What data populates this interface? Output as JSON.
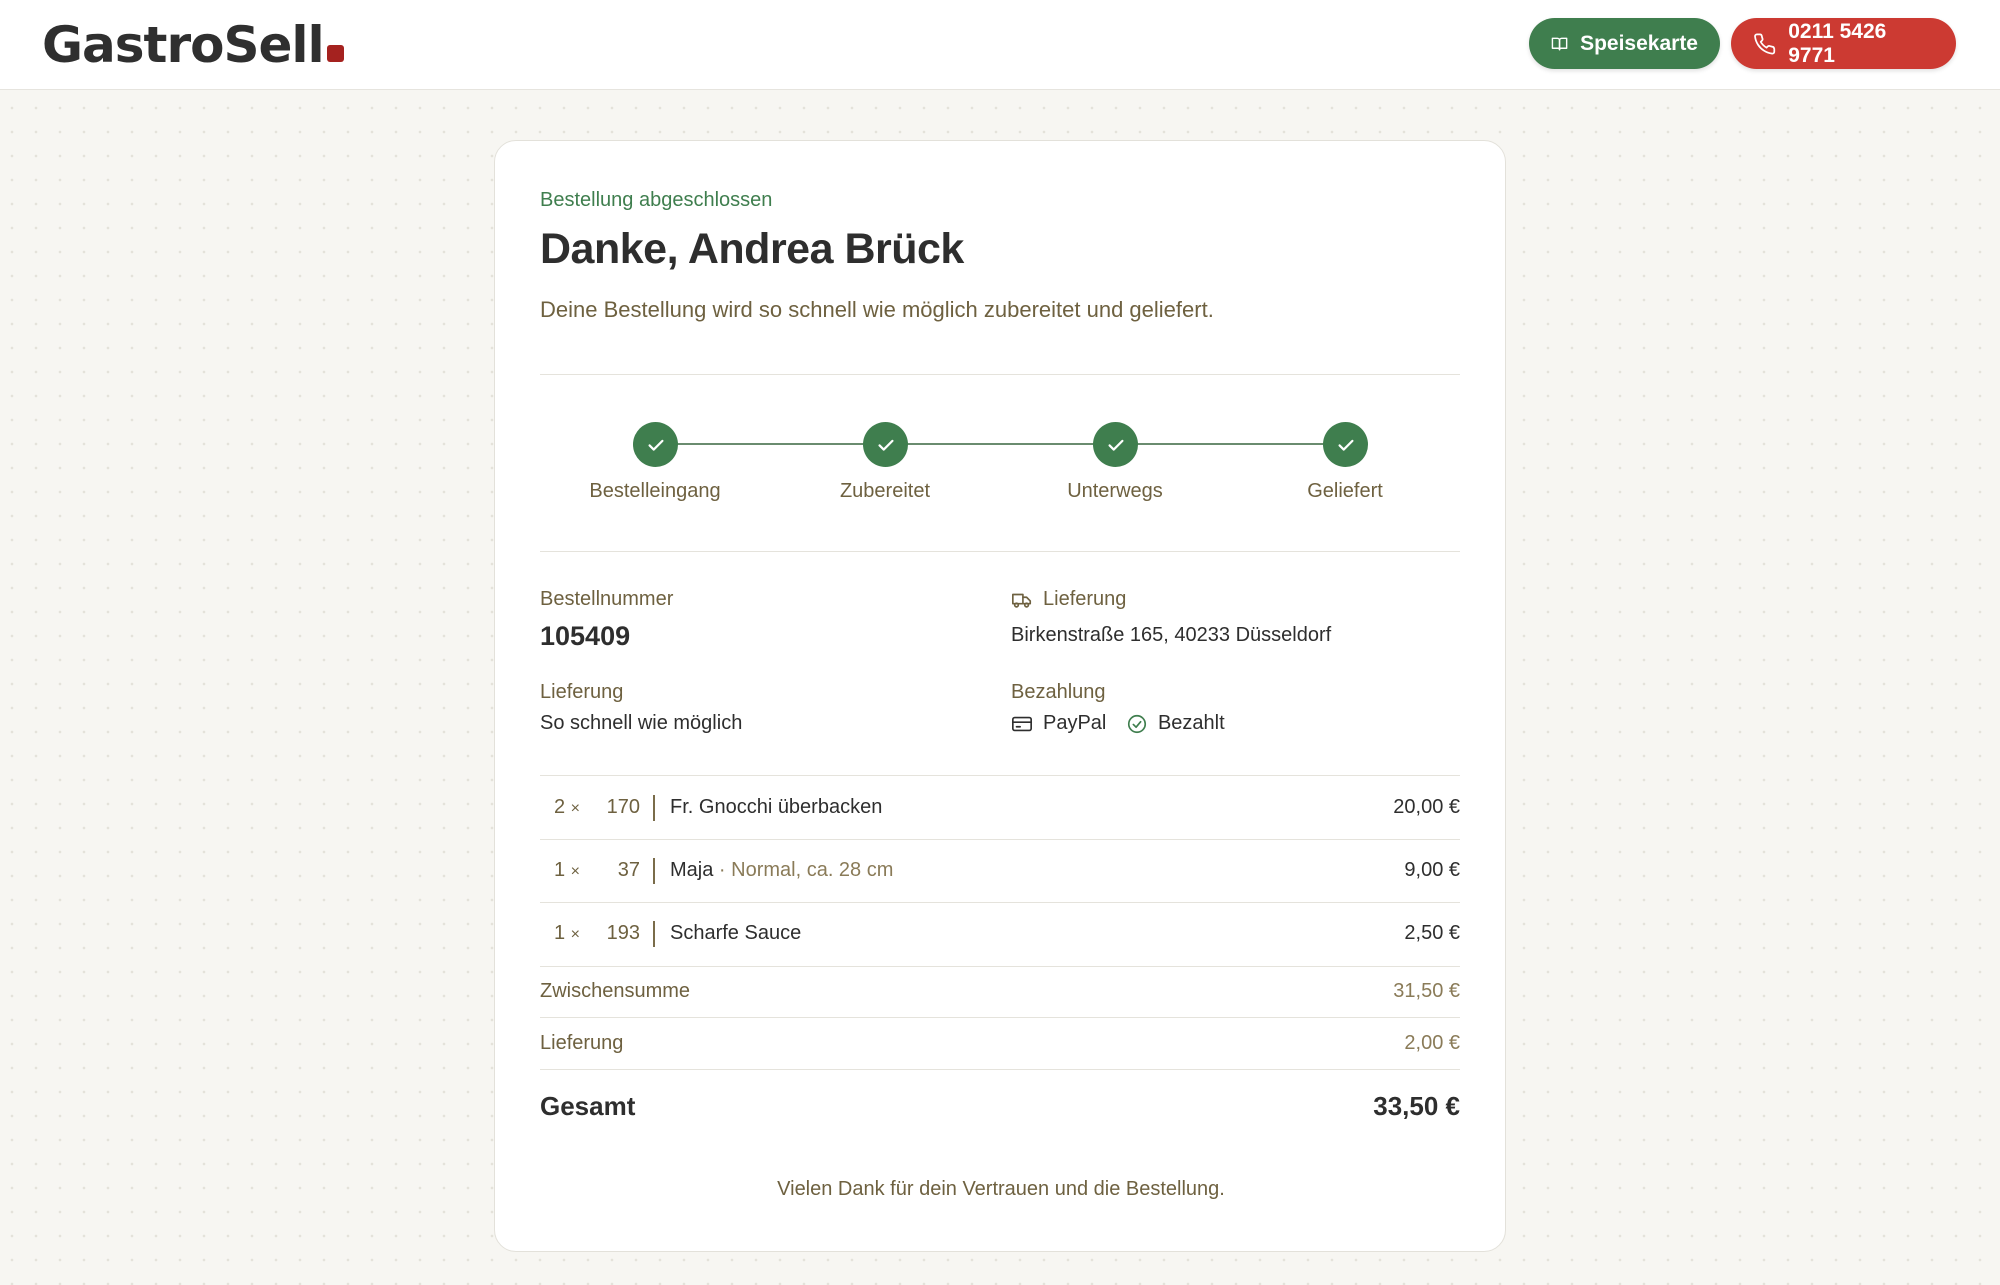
{
  "header": {
    "logo": "GastroSell",
    "menu_button": "Speisekarte",
    "phone_button": "0211 5426 9771"
  },
  "order": {
    "status_eyebrow": "Bestellung abgeschlossen",
    "title": "Danke, Andrea Brück",
    "subtitle": "Deine Bestellung wird so schnell wie möglich zubereitet und geliefert.",
    "steps": [
      {
        "label": "Bestelleingang"
      },
      {
        "label": "Zubereitet"
      },
      {
        "label": "Unterwegs"
      },
      {
        "label": "Geliefert"
      }
    ],
    "order_number_label": "Bestellnummer",
    "order_number": "105409",
    "delivery_label": "Lieferung",
    "delivery_address": "Birkenstraße 165, 40233 Düsseldorf",
    "delivery_time_label": "Lieferung",
    "delivery_time": "So schnell wie möglich",
    "payment_label": "Bezahlung",
    "payment_method": "PayPal",
    "payment_status": "Bezahlt",
    "items": [
      {
        "qty": "2",
        "x": "×",
        "number": "170",
        "name": "Fr. Gnocchi überbacken",
        "variant": "",
        "price": "20,00 €"
      },
      {
        "qty": "1",
        "x": "×",
        "number": "37",
        "name": "Maja",
        "variant": " · Normal, ca. 28 cm",
        "price": "9,00 €"
      },
      {
        "qty": "1",
        "x": "×",
        "number": "193",
        "name": "Scharfe Sauce",
        "variant": "",
        "price": "2,50 €"
      }
    ],
    "subtotal_label": "Zwischensumme",
    "subtotal": "31,50 €",
    "delivery_fee_label": "Lieferung",
    "delivery_fee": "2,00 €",
    "total_label": "Gesamt",
    "total": "33,50 €",
    "thanks": "Vielen Dank für dein Vertrauen und die Bestellung."
  }
}
